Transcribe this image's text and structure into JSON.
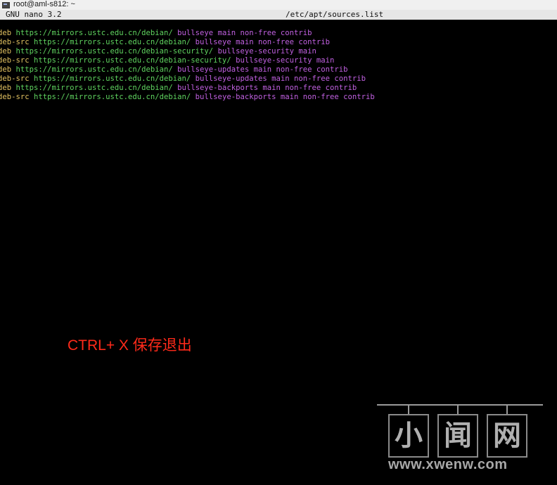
{
  "window": {
    "title": "root@aml-s812: ~",
    "icon": "terminal-icon"
  },
  "nano": {
    "version": "GNU nano 3.2",
    "filename": "/etc/apt/sources.list"
  },
  "lines": [
    {
      "type": "deb",
      "url": "https://mirrors.ustc.edu.cn/debian/",
      "dist": "bullseye",
      "components": "main non-free contrib"
    },
    {
      "type": "deb-src",
      "url": "https://mirrors.ustc.edu.cn/debian/",
      "dist": "bullseye",
      "components": "main non-free contrib"
    },
    {
      "type": "deb",
      "url": "https://mirrors.ustc.edu.cn/debian-security/",
      "dist": "bullseye-security",
      "components": "main"
    },
    {
      "type": "deb-src",
      "url": "https://mirrors.ustc.edu.cn/debian-security/",
      "dist": "bullseye-security",
      "components": "main"
    },
    {
      "type": "deb",
      "url": "https://mirrors.ustc.edu.cn/debian/",
      "dist": "bullseye-updates",
      "components": "main non-free contrib"
    },
    {
      "type": "deb-src",
      "url": "https://mirrors.ustc.edu.cn/debian/",
      "dist": "bullseye-updates",
      "components": "main non-free contrib"
    },
    {
      "type": "deb",
      "url": "https://mirrors.ustc.edu.cn/debian/",
      "dist": "bullseye-backports",
      "components": "main non-free contrib"
    },
    {
      "type": "deb-src",
      "url": "https://mirrors.ustc.edu.cn/debian/",
      "dist": "bullseye-backports",
      "components": "main non-free contrib"
    }
  ],
  "annotation": {
    "text": "CTRL+ X 保存退出",
    "color": "#ff2a1a"
  },
  "watermark": {
    "chars": [
      "小",
      "闻",
      "网"
    ],
    "site": "www.xwenw.com"
  },
  "colors": {
    "background": "#000000",
    "type": "#e0c060",
    "url": "#5fd35f",
    "dist": "#c060e0",
    "components": "#c060e0"
  }
}
